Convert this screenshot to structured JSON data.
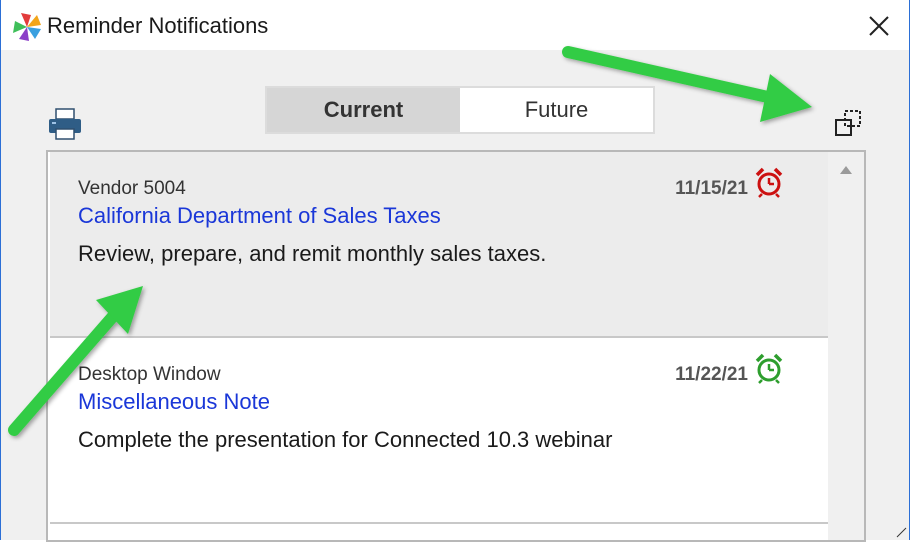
{
  "window": {
    "title": "Reminder Notifications",
    "accent_color": "#2b6fd6"
  },
  "tabs": [
    {
      "label": "Current",
      "active": true
    },
    {
      "label": "Future",
      "active": false
    }
  ],
  "icons": {
    "app": "pinwheel-logo-icon",
    "close": "close-icon",
    "print": "printer-icon",
    "popout": "popout-window-icon",
    "alarm": "alarm-clock-icon"
  },
  "reminders": [
    {
      "source": "Vendor 5004",
      "title": "California Department of Sales Taxes",
      "description": "Review, prepare, and remit monthly sales taxes.",
      "date": "11/15/21",
      "alarm_color": "#cc1111"
    },
    {
      "source": "Desktop Window",
      "title": "Miscellaneous Note",
      "description": "Complete the presentation for Connected 10.3 webinar",
      "date": "11/22/21",
      "alarm_color": "#2e9e2e"
    }
  ],
  "annotation_color": "#33cc44"
}
